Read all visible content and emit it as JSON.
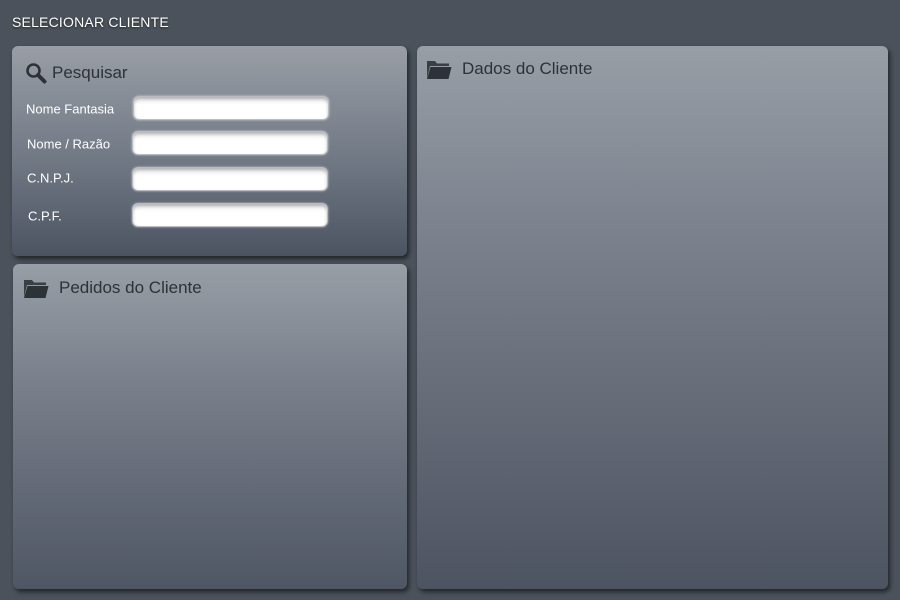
{
  "page": {
    "title": "SELECIONAR CLIENTE"
  },
  "search_panel": {
    "title": "Pesquisar",
    "icon": "magnifier-icon",
    "fields": [
      {
        "label": "Nome Fantasia",
        "value": "",
        "placeholder": ""
      },
      {
        "label": "Nome / Razão",
        "value": "",
        "placeholder": ""
      },
      {
        "label": "C.N.P.J.",
        "value": "",
        "placeholder": ""
      },
      {
        "label": "C.P.F.",
        "value": "",
        "placeholder": ""
      }
    ]
  },
  "orders_panel": {
    "title": "Pedidos do Cliente",
    "icon": "folder-icon"
  },
  "client_panel": {
    "title": "Dados do Cliente",
    "icon": "folder-icon"
  },
  "colors": {
    "background": "#4b525b",
    "panel_top": "#999ea6",
    "panel_bottom": "#4c5462",
    "header_text": "#2d3238",
    "label_text": "#ffffff"
  }
}
